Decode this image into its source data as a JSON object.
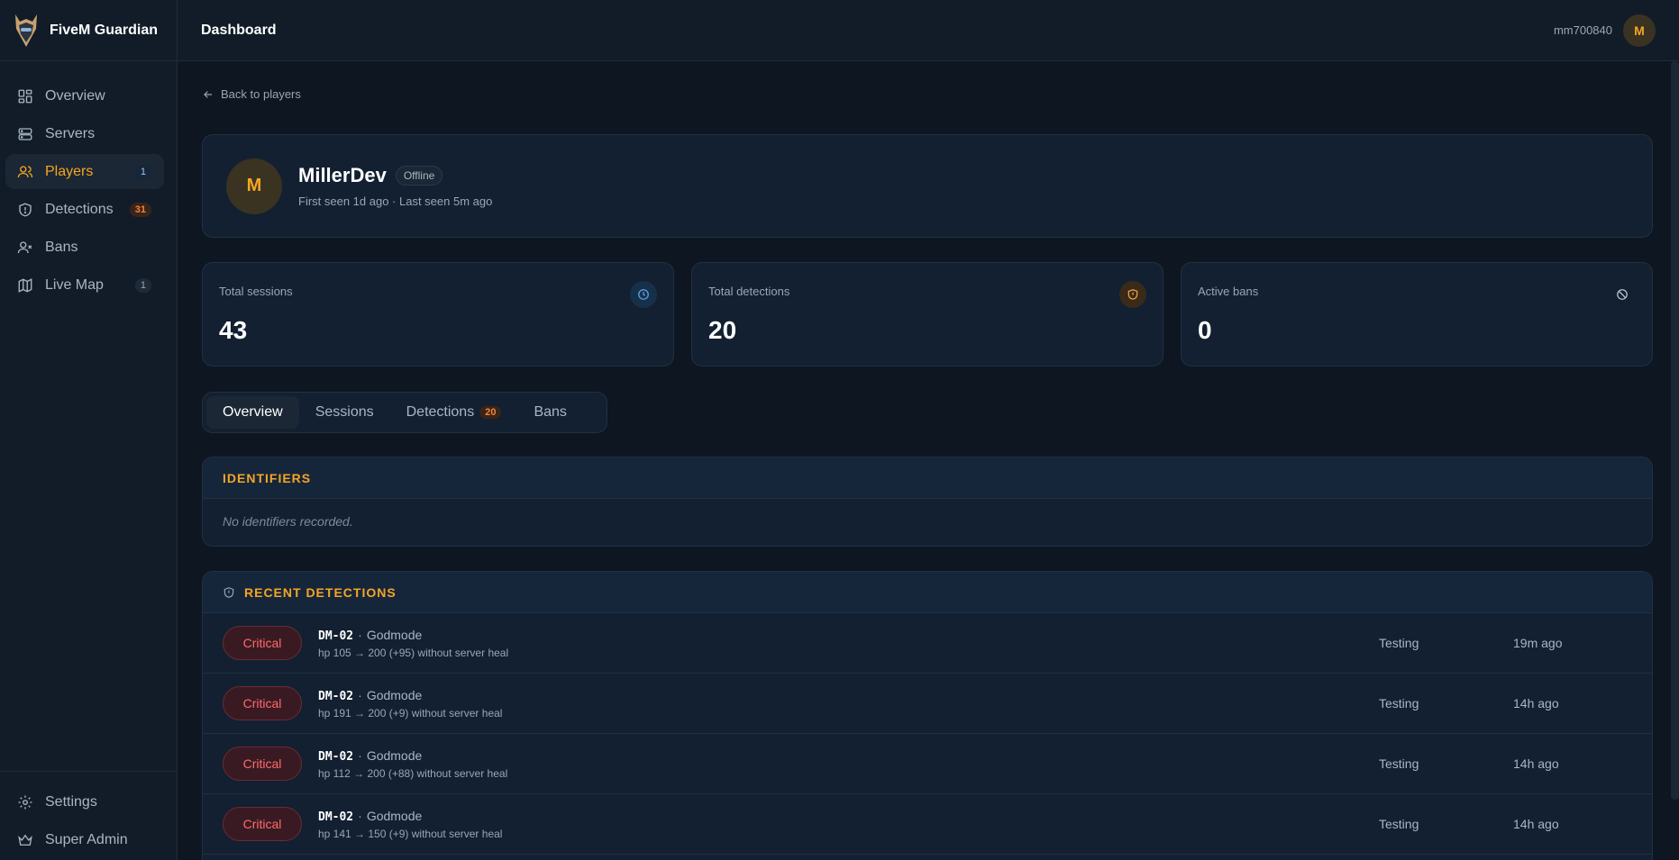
{
  "app": {
    "name": "FiveM Guardian"
  },
  "header": {
    "title": "Dashboard",
    "username": "mm700840",
    "avatar_initial": "M"
  },
  "sidebar": {
    "items": [
      {
        "label": "Overview",
        "icon": "grid-icon",
        "badge": ""
      },
      {
        "label": "Servers",
        "icon": "server-icon",
        "badge": ""
      },
      {
        "label": "Players",
        "icon": "users-icon",
        "badge": "1",
        "active": true
      },
      {
        "label": "Detections",
        "icon": "shield-icon",
        "badge": "31"
      },
      {
        "label": "Bans",
        "icon": "user-x-icon",
        "badge": ""
      },
      {
        "label": "Live Map",
        "icon": "map-icon",
        "badge": "1"
      }
    ],
    "bottom": [
      {
        "label": "Settings",
        "icon": "gear-icon"
      },
      {
        "label": "Super Admin",
        "icon": "crown-icon"
      }
    ]
  },
  "main": {
    "back_label": "Back to players",
    "profile": {
      "initial": "M",
      "name": "MillerDev",
      "status": "Offline",
      "subtitle": "First seen 1d ago · Last seen 5m ago"
    },
    "stats": [
      {
        "label": "Total sessions",
        "value": "43",
        "icon": "clock-icon"
      },
      {
        "label": "Total detections",
        "value": "20",
        "icon": "shield-icon"
      },
      {
        "label": "Active bans",
        "value": "0",
        "icon": "ban-icon"
      }
    ],
    "tabs": [
      {
        "label": "Overview",
        "badge": ""
      },
      {
        "label": "Sessions",
        "badge": ""
      },
      {
        "label": "Detections",
        "badge": "20"
      },
      {
        "label": "Bans",
        "badge": ""
      }
    ],
    "identifiers": {
      "title": "IDENTIFIERS",
      "empty": "No identifiers recorded."
    },
    "recent_detections": {
      "title": "RECENT DETECTIONS",
      "rows": [
        {
          "severity": "Critical",
          "code": "DM-02",
          "type": "Godmode",
          "desc": "hp 105 → 200 (+95) without server heal",
          "server": "Testing",
          "time": "19m ago"
        },
        {
          "severity": "Critical",
          "code": "DM-02",
          "type": "Godmode",
          "desc": "hp 191 → 200 (+9) without server heal",
          "server": "Testing",
          "time": "14h ago"
        },
        {
          "severity": "Critical",
          "code": "DM-02",
          "type": "Godmode",
          "desc": "hp 112 → 200 (+88) without server heal",
          "server": "Testing",
          "time": "14h ago"
        },
        {
          "severity": "Critical",
          "code": "DM-02",
          "type": "Godmode",
          "desc": "hp 141 → 150 (+9) without server heal",
          "server": "Testing",
          "time": "14h ago"
        }
      ]
    }
  },
  "colors": {
    "accent": "#f5a524",
    "critical": "#ff6b6b",
    "background": "#0d1621"
  }
}
